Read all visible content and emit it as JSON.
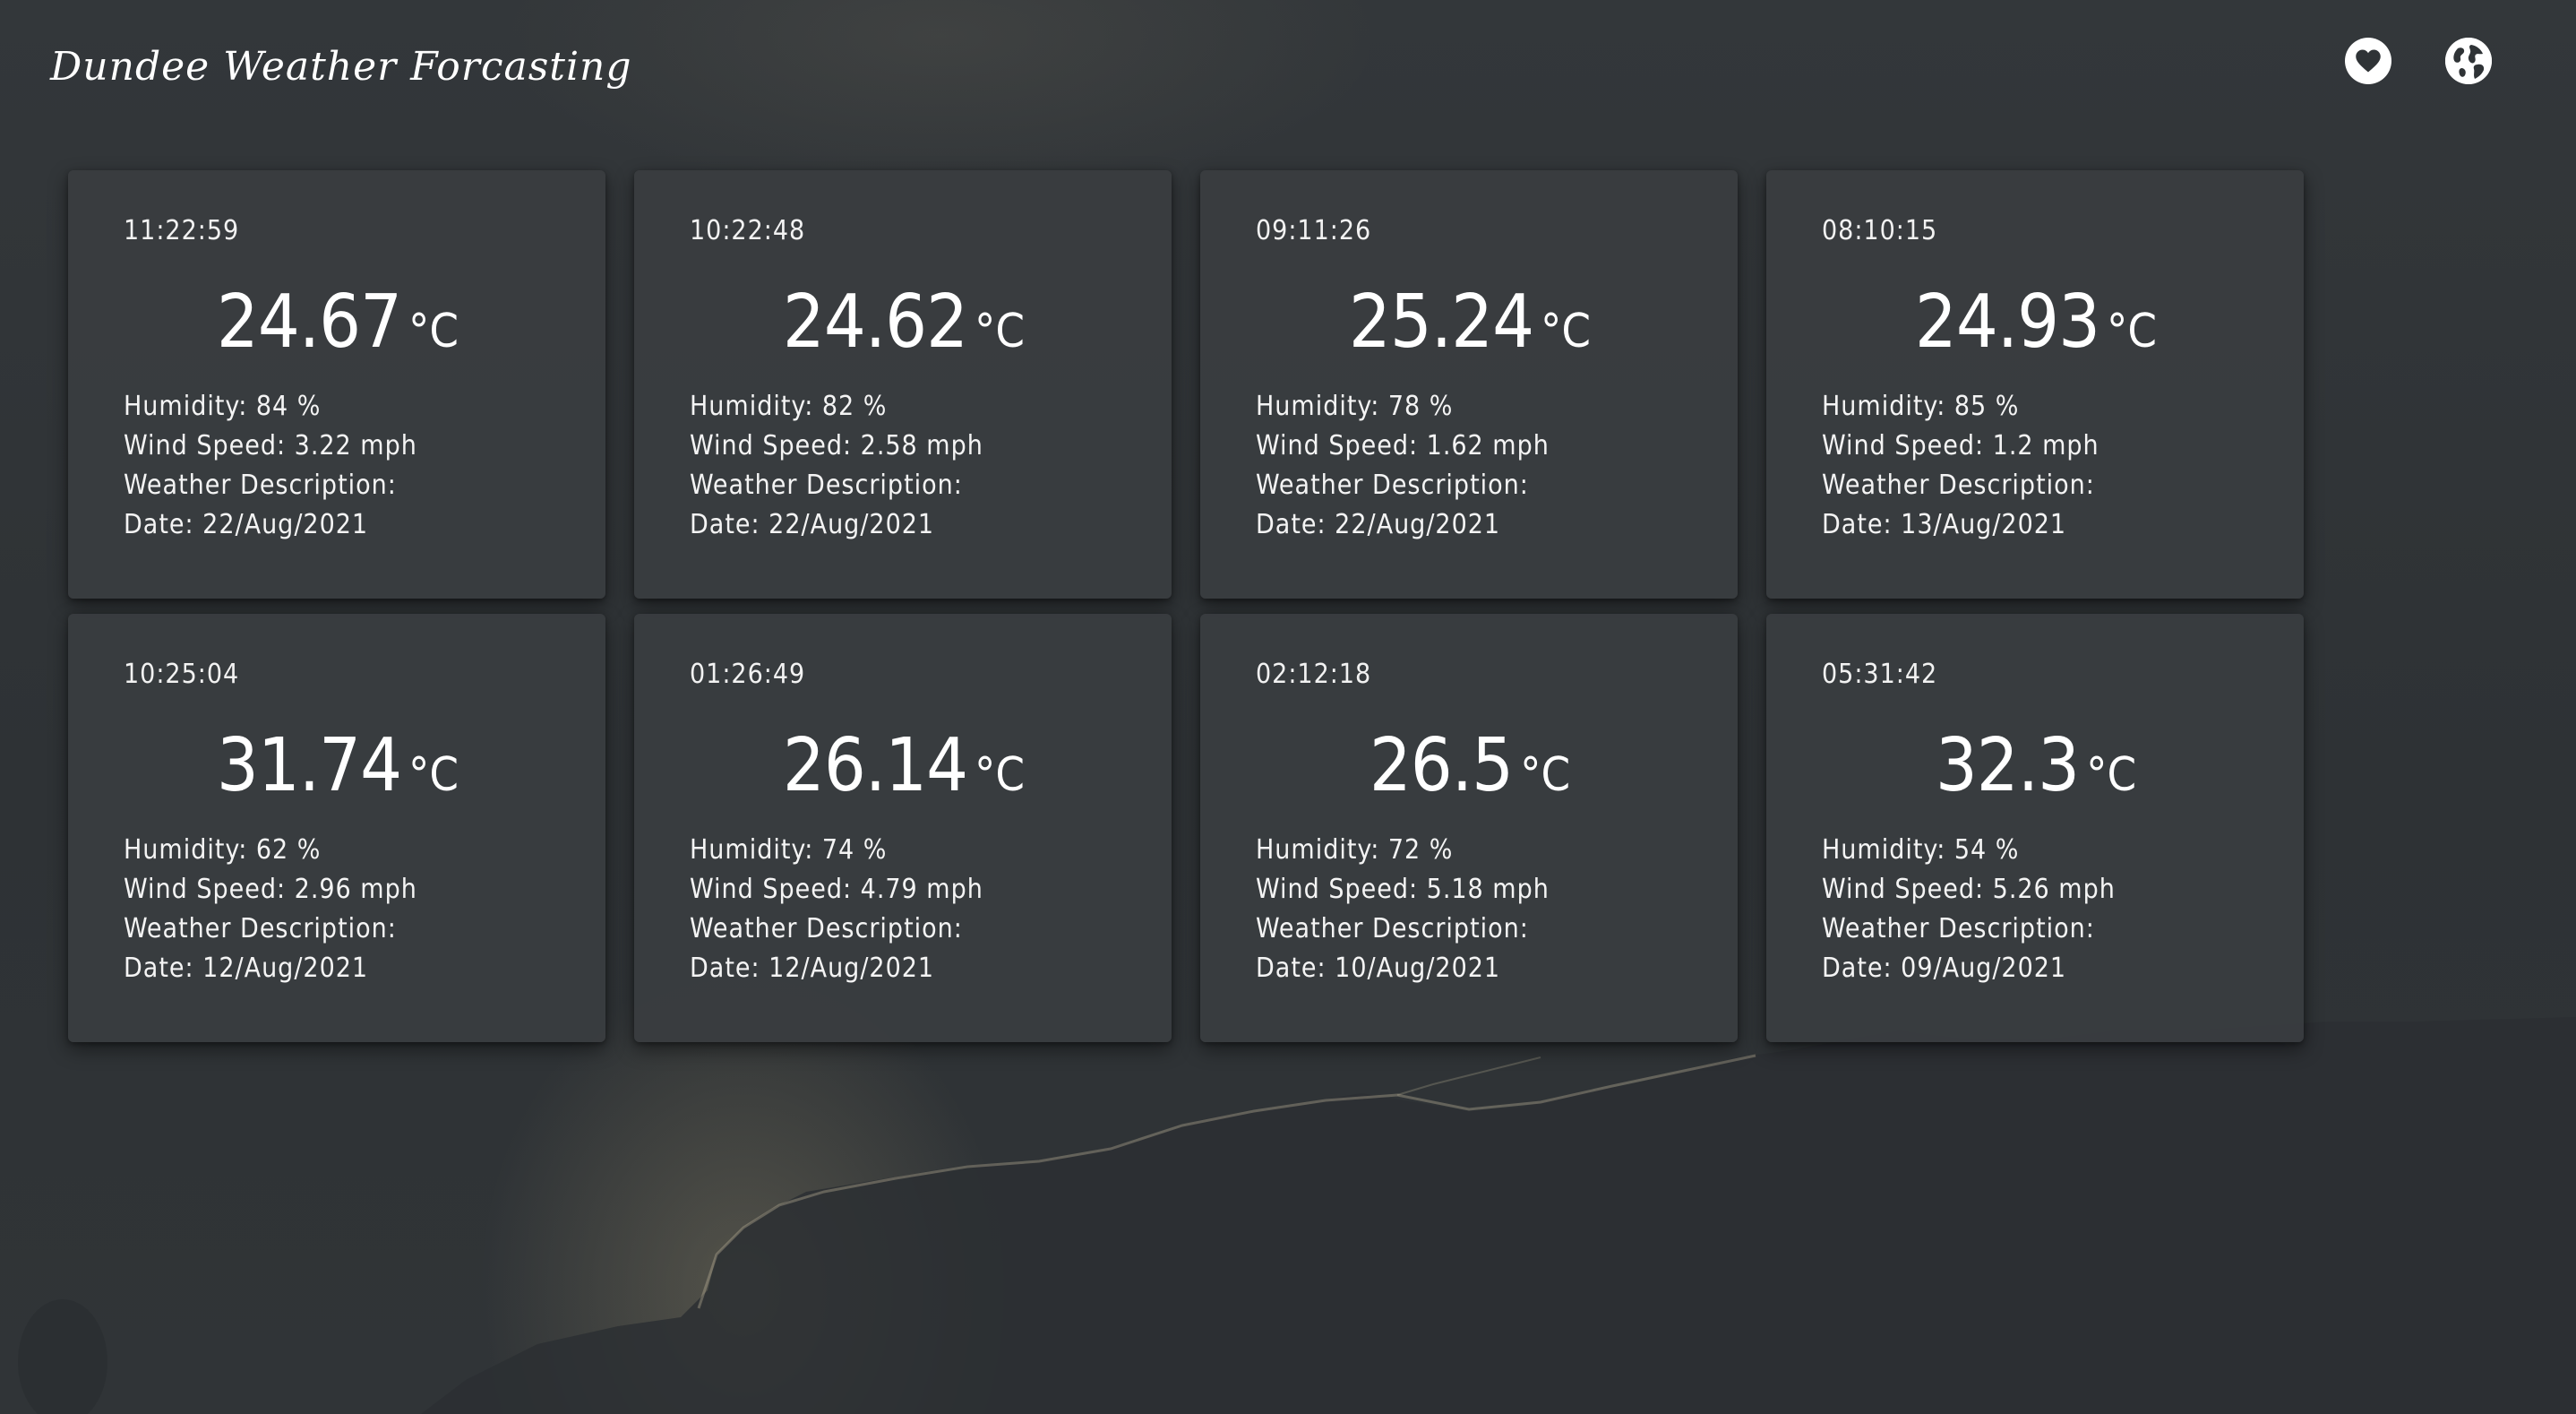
{
  "app": {
    "title": "Dundee Weather Forcasting"
  },
  "header": {
    "icons": [
      "heart-icon",
      "globe-icon"
    ]
  },
  "labels": {
    "humidity": "Humidity:",
    "wind_speed": "Wind Speed:",
    "weather_description": "Weather Description:",
    "date": "Date:",
    "unit": "°C"
  },
  "cards": [
    {
      "time": "11:22:59",
      "temp": "24.67",
      "unit": "°C",
      "humidity": "Humidity: 84 %",
      "wind": "Wind Speed: 3.22 mph",
      "description": "Weather Description:",
      "date": "Date: 22/Aug/2021"
    },
    {
      "time": "10:22:48",
      "temp": "24.62",
      "unit": "°C",
      "humidity": "Humidity: 82 %",
      "wind": "Wind Speed: 2.58 mph",
      "description": "Weather Description:",
      "date": "Date: 22/Aug/2021"
    },
    {
      "time": "09:11:26",
      "temp": "25.24",
      "unit": "°C",
      "humidity": "Humidity: 78 %",
      "wind": "Wind Speed: 1.62 mph",
      "description": "Weather Description:",
      "date": "Date: 22/Aug/2021"
    },
    {
      "time": "08:10:15",
      "temp": "24.93",
      "unit": "°C",
      "humidity": "Humidity: 85 %",
      "wind": "Wind Speed: 1.2 mph",
      "description": "Weather Description:",
      "date": "Date: 13/Aug/2021"
    },
    {
      "time": "10:25:04",
      "temp": "31.74",
      "unit": "°C",
      "humidity": "Humidity: 62 %",
      "wind": "Wind Speed: 2.96 mph",
      "description": "Weather Description:",
      "date": "Date: 12/Aug/2021"
    },
    {
      "time": "01:26:49",
      "temp": "26.14",
      "unit": "°C",
      "humidity": "Humidity: 74 %",
      "wind": "Wind Speed: 4.79 mph",
      "description": "Weather Description:",
      "date": "Date: 12/Aug/2021"
    },
    {
      "time": "02:12:18",
      "temp": "26.5",
      "unit": "°C",
      "humidity": "Humidity: 72 %",
      "wind": "Wind Speed: 5.18 mph",
      "description": "Weather Description:",
      "date": "Date: 10/Aug/2021"
    },
    {
      "time": "05:31:42",
      "temp": "32.3",
      "unit": "°C",
      "humidity": "Humidity: 54 %",
      "wind": "Wind Speed: 5.26 mph",
      "description": "Weather Description:",
      "date": "Date: 09/Aug/2021"
    }
  ],
  "colors": {
    "background": "#2f3336",
    "card": "#3a3d40",
    "text": "#ffffff"
  }
}
